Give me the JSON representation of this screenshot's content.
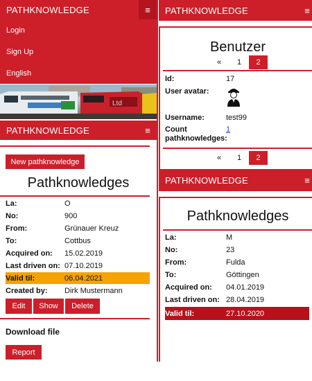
{
  "brand": "PATHKNOWLEDGE",
  "menu": {
    "login": "Login",
    "signup": "Sign Up",
    "language": "English"
  },
  "burger_glyph": "≡",
  "left": {
    "new_button": "New pathknowledge",
    "title": "Pathknowledges",
    "fields": {
      "la": {
        "label": "La:",
        "value": "O"
      },
      "no": {
        "label": "No:",
        "value": "900"
      },
      "from": {
        "label": "From:",
        "value": "Grünauer Kreuz"
      },
      "to": {
        "label": "To:",
        "value": "Cottbus"
      },
      "acquired": {
        "label": "Acquired on:",
        "value": "15.02.2019"
      },
      "last_driven": {
        "label": "Last driven on:",
        "value": "07.10.2019"
      },
      "valid_til": {
        "label": "Valid til:",
        "value": "06.04.2021"
      },
      "created_by": {
        "label": "Created by:",
        "value": "Dirk Mustermann"
      }
    },
    "actions": {
      "edit": "Edit",
      "show": "Show",
      "delete": "Delete"
    },
    "download_heading": "Download file",
    "report_button": "Report",
    "valid_highlight": "#f5a300"
  },
  "right_top": {
    "title": "Benutzer",
    "pagination": {
      "prev": "«",
      "p1": "1",
      "p2": "2"
    },
    "fields": {
      "id": {
        "label": "Id:",
        "value": "17"
      },
      "avatar": {
        "label": "User avatar:"
      },
      "username": {
        "label": "Username:",
        "value": "test99"
      },
      "count": {
        "label_line1": "Count",
        "label_line2": "pathknowledges:",
        "value": "1"
      }
    }
  },
  "right_bottom": {
    "title": "Pathknowledges",
    "fields": {
      "la": {
        "label": "La:",
        "value": "M"
      },
      "no": {
        "label": "No:",
        "value": "23"
      },
      "from": {
        "label": "From:",
        "value": "Fulda"
      },
      "to": {
        "label": "To:",
        "value": "Göttingen"
      },
      "acquired": {
        "label": "Acquired on:",
        "value": "04.01.2019"
      },
      "last_driven": {
        "label": "Last driven on:",
        "value": "28.04.2019"
      },
      "valid_til": {
        "label": "Valid til:",
        "value": "27.10.2020"
      }
    },
    "valid_highlight": "#b8111b"
  },
  "colors": {
    "accent": "#cc1f2a"
  }
}
